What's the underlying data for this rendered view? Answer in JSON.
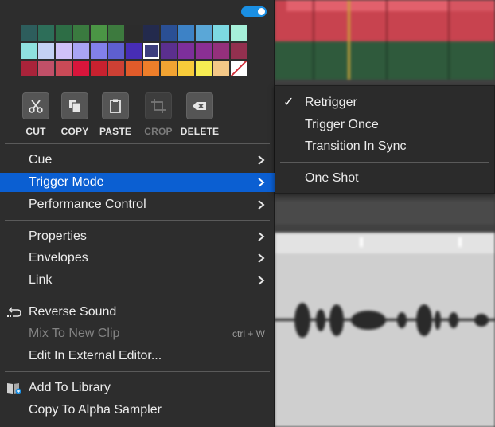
{
  "palette": [
    "#2d5d5c",
    "#2d6e59",
    "#2d6d45",
    "#3a7a3f",
    "#4b9545",
    "#3d7a3e",
    "#2c2c2c",
    "#232a4d",
    "#2a4f94",
    "#3d82c6",
    "#5aa7d7",
    "#7dd9e2",
    "#a6f0d9",
    "#8fe1df",
    "#c4d1f4",
    "#d0c1f8",
    "#a9a4f4",
    "#8280ea",
    "#5e5fd0",
    "#472db6",
    "#3e3f7e",
    "#5b2f8e",
    "#7d2f9b",
    "#8b2f94",
    "#94307c",
    "#92304f",
    "#a9233a",
    "#c05068",
    "#c94a57",
    "#d8153b",
    "#c8212f",
    "#cd4034",
    "#e15b2a",
    "#ee7e2a",
    "#f2a332",
    "#f7cb3a",
    "#f6ec52",
    "#f4c887",
    "#ffffff"
  ],
  "palette_selected_index": 20,
  "colors": {
    "highlight": "#0b5fd2",
    "toggle": "#1a8fe3",
    "menu_bg": "#2d2d2d"
  },
  "tools": [
    {
      "label": "CUT",
      "icon": "scissors-icon",
      "enabled": true
    },
    {
      "label": "COPY",
      "icon": "copy-icon",
      "enabled": true
    },
    {
      "label": "PASTE",
      "icon": "clipboard-icon",
      "enabled": true
    },
    {
      "label": "CROP",
      "icon": "crop-icon",
      "enabled": false
    },
    {
      "label": "DELETE",
      "icon": "backspace-icon",
      "enabled": true
    }
  ],
  "menu": {
    "cue": "Cue",
    "trigger_mode": "Trigger Mode",
    "performance_control": "Performance Control",
    "properties": "Properties",
    "envelopes": "Envelopes",
    "link": "Link",
    "reverse_sound": "Reverse Sound",
    "mix_to_new_clip": "Mix To New Clip",
    "mix_shortcut": "ctrl + W",
    "edit_external": "Edit In External Editor...",
    "add_to_library": "Add To Library",
    "copy_to_alpha": "Copy To Alpha Sampler"
  },
  "submenu": {
    "check": "✓",
    "retrigger": "Retrigger",
    "trigger_once": "Trigger Once",
    "transition_in_sync": "Transition In Sync",
    "one_shot": "One Shot",
    "selected": "retrigger"
  }
}
